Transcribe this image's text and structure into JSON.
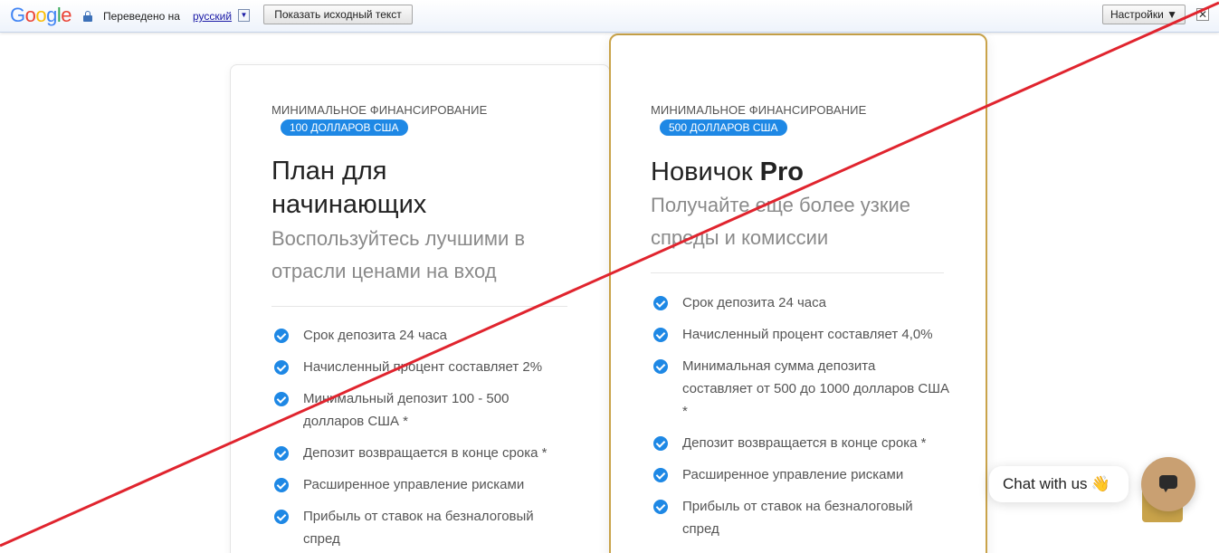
{
  "translate_bar": {
    "logo": [
      "G",
      "o",
      "o",
      "g",
      "l",
      "e"
    ],
    "translated_label": "Переведено на",
    "language": "русский",
    "language_arrow": "▼",
    "show_original_label": "Показать исходный текст",
    "settings_label": "Настройки ▼",
    "close_label": "✕",
    "icons": {
      "lock": "lock-icon",
      "close": "close-icon"
    }
  },
  "plans": [
    {
      "funding_label": "МИНИМАЛЬНОЕ ФИНАНСИРОВАНИЕ",
      "funding_amount": "100 ДОЛЛАРОВ США",
      "title_line1": "План для",
      "title_line2": "начинающих",
      "subtitle_line1": "Воспользуйтесь лучшими в",
      "subtitle_line2": "отрасли ценами на вход",
      "features": [
        "Срок депозита 24 часа",
        "Начисленный процент составляет 2%",
        "Минимальный депозит 100 - 500 долларов США *",
        "Депозит возвращается в конце срока *",
        "Расширенное управление рисками",
        "Прибыль от ставок на безналоговый спред"
      ]
    },
    {
      "funding_label": "МИНИМАЛЬНОЕ ФИНАНСИРОВАНИЕ",
      "funding_amount": "500 ДОЛЛАРОВ США",
      "title_main": "Новичок ",
      "title_bold": "Pro",
      "subtitle_line1": "Получайте еще более узкие",
      "subtitle_line2": "спреды и комиссии",
      "features": [
        "Срок депозита 24 часа",
        "Начисленный процент составляет 4,0%",
        "Минимальная сумма депозита составляет от 500 до 1000 долларов США *",
        "Депозит возвращается в конце срока *",
        "Расширенное управление рисками",
        "Прибыль от ставок на безналоговый спред"
      ]
    }
  ],
  "chat": {
    "label": "Chat with us",
    "wave_icon": "👋",
    "button_icon": "chat-icon"
  },
  "colors": {
    "accent_blue": "#1e88e5",
    "gold_border": "#c9a34a",
    "chat_button": "#c9a072",
    "strike_line": "#e0242e"
  }
}
